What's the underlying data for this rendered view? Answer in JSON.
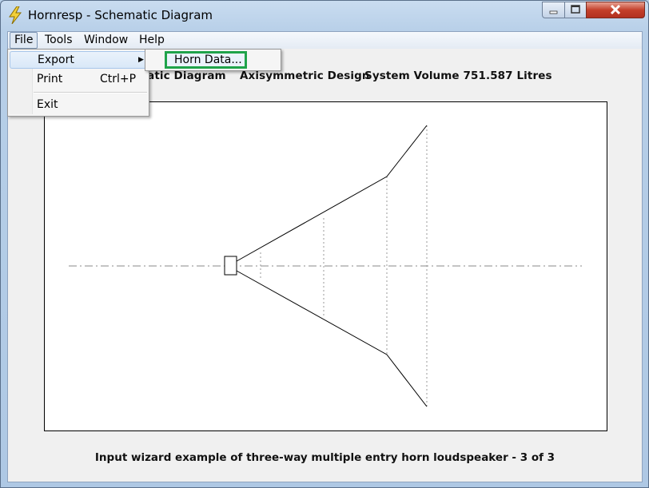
{
  "window": {
    "title": "Hornresp - Schematic Diagram",
    "icon": "lightning-icon"
  },
  "menubar": {
    "items": [
      "File",
      "Tools",
      "Window",
      "Help"
    ]
  },
  "file_menu": {
    "export_label": "Export",
    "print_label": "Print",
    "print_shortcut": "Ctrl+P",
    "exit_label": "Exit"
  },
  "export_submenu": {
    "horn_data_label": "Horn Data..."
  },
  "header": {
    "diagram_fragment": "matic Diagram",
    "design": "Axisymmetric Design",
    "volume": "System Volume 751.587 Litres"
  },
  "caption": "Input wizard example of three-way multiple entry horn loudspeaker  -  3 of 3",
  "colors": {
    "highlight_border": "#1fa34a",
    "close_button": "#c4402b"
  }
}
